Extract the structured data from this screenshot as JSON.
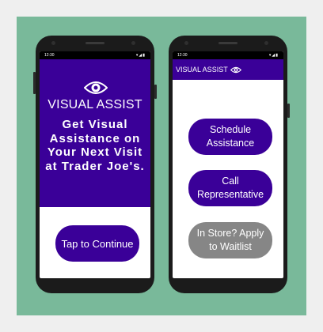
{
  "left_phone": {
    "status": {
      "time": "12:30",
      "icons": "▾◢▮"
    },
    "brand": "VISUAL ASSIST",
    "tagline": "Get Visual Assistance on Your Next Visit at Trader Joe's.",
    "cta_label": "Tap to Continue"
  },
  "right_phone": {
    "status": {
      "time": "12:30",
      "icons": "▾◢▮"
    },
    "appbar_title": "VISUAL ASSIST",
    "buttons": [
      {
        "label": "Schedule Assistance"
      },
      {
        "label": "Call Representative"
      },
      {
        "label": "In Store? Apply to Waitlist"
      }
    ]
  },
  "colors": {
    "brand_purple": "#3a0098",
    "disabled_gray": "#868686",
    "background_green": "#79b99a"
  },
  "icons": [
    "eye-icon",
    "wifi-icon",
    "signal-icon",
    "battery-icon"
  ]
}
